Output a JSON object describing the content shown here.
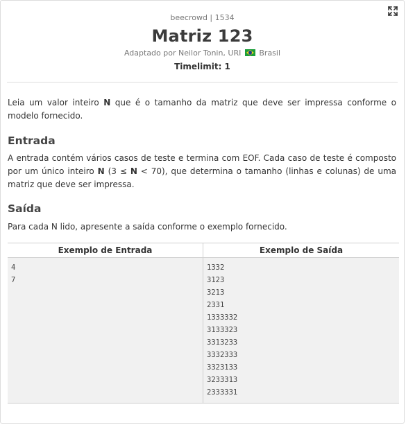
{
  "problem": {
    "source": "beecrowd | 1534",
    "title": "Matriz 123",
    "author_prefix": "Adaptado por Neilor Tonin, URI",
    "country": "Brasil",
    "timelimit": "Timelimit: 1"
  },
  "description": {
    "p1_a": "Leia um valor inteiro ",
    "p1_b": "N",
    "p1_c": " que é o tamanho da matriz que deve ser impressa conforme o modelo fornecido."
  },
  "input_section": {
    "title": "Entrada",
    "t_a": "A entrada contém vários casos de teste e termina com EOF. Cada caso de teste é composto por um único inteiro ",
    "t_b": "N",
    "t_c": " (3 ≤ ",
    "t_d": "N",
    "t_e": " < 70), que determina o tamanho (linhas e colunas) de uma matriz que deve ser impressa."
  },
  "output_section": {
    "title": "Saída",
    "text": "Para cada N lido, apresente a saída conforme o exemplo fornecido."
  },
  "samples": {
    "input_header": "Exemplo de Entrada",
    "output_header": "Exemplo de Saída",
    "input_lines": [
      "4",
      "7"
    ],
    "output_lines": [
      "1332",
      "3123",
      "3213",
      "2331",
      "1333332",
      "3133323",
      "3313233",
      "3332333",
      "3323133",
      "3233313",
      "2333331"
    ]
  },
  "icons": {
    "expand": "expand-arrows-icon",
    "flag": "brazil-flag-icon"
  },
  "colors": {
    "sample_background": "#f1f1f1",
    "border": "#cfcfcf"
  }
}
